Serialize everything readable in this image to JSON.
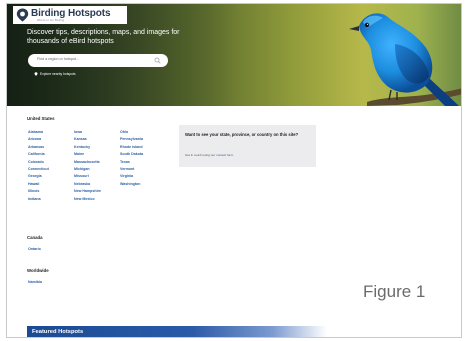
{
  "header": {
    "site_title": "Birding Hotspots",
    "site_subtitle": "Where to Go Birding",
    "tagline": "Discover tips, descriptions, maps, and images for thousands of eBird hotspots",
    "search_placeholder": "Find a region or hotspot...",
    "nearby_link": "Explore nearby hotspots"
  },
  "united_states": {
    "title": "United States",
    "col1": [
      "Alabama",
      "Arizona",
      "Arkansas",
      "California",
      "Colorado",
      "Connecticut",
      "Georgia",
      "Hawaii",
      "Illinois",
      "Indiana"
    ],
    "col2": [
      "Iowa",
      "Kansas",
      "Kentucky",
      "Maine",
      "Massachusetts",
      "Michigan",
      "Missouri",
      "Nebraska",
      "New Hampshire",
      "New Mexico"
    ],
    "col3": [
      "Ohio",
      "Pennsylvania",
      "Rhode Island",
      "South Dakota",
      "Texas",
      "Vermont",
      "Virginia",
      "Washington"
    ]
  },
  "cta": {
    "title": "Want to see your state, province, or country on this site?",
    "text_before": "Get in touch using our ",
    "link": "contact form",
    "text_after": "."
  },
  "canada": {
    "title": "Canada",
    "items": [
      "Ontario"
    ]
  },
  "worldwide": {
    "title": "Worldwide",
    "items": [
      "Namibia"
    ]
  },
  "figure_label": "Figure 1",
  "featured": {
    "title": "Featured Hotspots"
  },
  "colors": {
    "link": "#2c5fa0",
    "accent": "#1c4a94",
    "bird_blue": "#1e8fe0"
  }
}
